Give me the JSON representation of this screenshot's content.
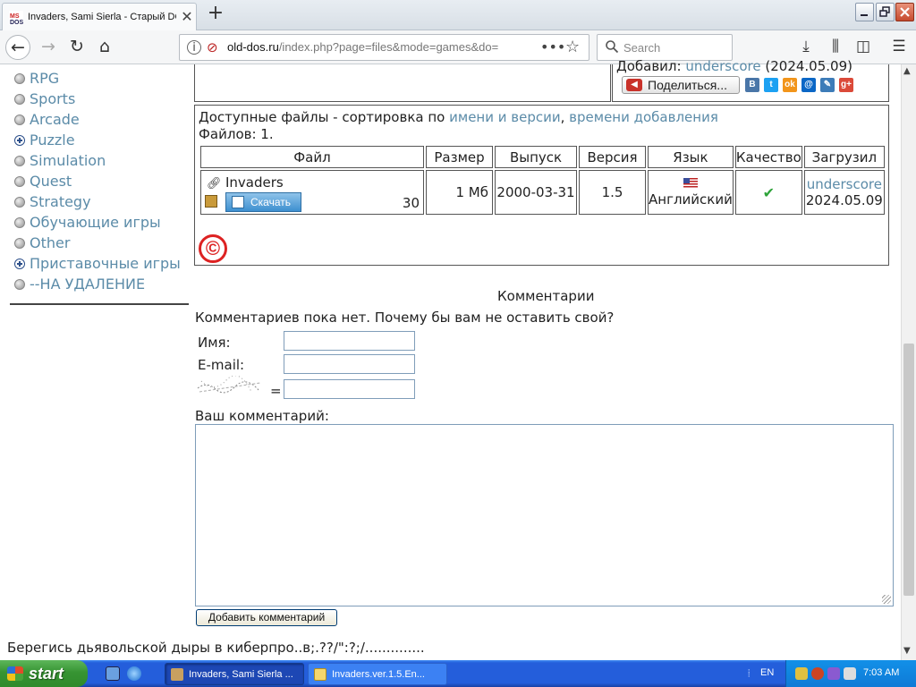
{
  "browser": {
    "tab_title": "Invaders, Sami Sierla - Старый DOS",
    "new_tab_label": "+",
    "url_host": "old-dos.ru",
    "url_path": "/index.php?page=files&mode=games&do=",
    "search_placeholder": "Search"
  },
  "sidebar": {
    "items": [
      {
        "label": "RPG",
        "icon": "bullet",
        "expandable": false
      },
      {
        "label": "Sports",
        "icon": "bullet",
        "expandable": false
      },
      {
        "label": "Arcade",
        "icon": "bullet",
        "expandable": false
      },
      {
        "label": "Puzzle",
        "icon": "plus",
        "expandable": true
      },
      {
        "label": "Simulation",
        "icon": "bullet",
        "expandable": false
      },
      {
        "label": "Quest",
        "icon": "bullet",
        "expandable": false
      },
      {
        "label": "Strategy",
        "icon": "bullet",
        "expandable": false
      },
      {
        "label": "Обучающие игры",
        "icon": "bullet",
        "expandable": false
      },
      {
        "label": "Other",
        "icon": "bullet",
        "expandable": false
      },
      {
        "label": "Приставочные игры",
        "icon": "plus",
        "expandable": true
      },
      {
        "label": "--НА УДАЛЕНИЕ",
        "icon": "bullet",
        "expandable": false
      }
    ]
  },
  "added": {
    "prefix": "Добавил:",
    "user": "underscore",
    "date": "(2024.05.09)"
  },
  "share": {
    "button_label": "Поделиться...",
    "networks": [
      {
        "name": "vk-icon",
        "glyph": "В",
        "color": "#4a76a8"
      },
      {
        "name": "twitter-icon",
        "glyph": "t",
        "color": "#1da1f2"
      },
      {
        "name": "odnoklassniki-icon",
        "glyph": "ok",
        "color": "#f2951b"
      },
      {
        "name": "mailru-icon",
        "glyph": "@",
        "color": "#0b67c6"
      },
      {
        "name": "livejournal-icon",
        "glyph": "✎",
        "color": "#3d7cb8"
      },
      {
        "name": "googleplus-icon",
        "glyph": "g+",
        "color": "#db4a39"
      }
    ]
  },
  "files": {
    "sort_prefix": "Доступные файлы - сортировка по",
    "sort_by_name": "имени и версии",
    "sort_separator": ",",
    "sort_by_date": "времени добавления",
    "count_label": "Файлов: 1.",
    "headers": [
      "Файл",
      "Размер",
      "Выпуск",
      "Версия",
      "Язык",
      "Качество",
      "Загрузил"
    ],
    "rows": [
      {
        "file_name": "Invaders",
        "download_label": "Скачать",
        "download_count": "30",
        "size": "1 Мб",
        "release": "2000-03-31",
        "version": "1.5",
        "language": "Английский",
        "quality": "good",
        "uploader": "underscore",
        "upload_date": "2024.05.09"
      }
    ],
    "copyright_glyph": "©"
  },
  "comments": {
    "title": "Комментарии",
    "empty_message": "Комментариев пока нет. Почему бы вам не оставить свой?",
    "name_label": "Имя:",
    "email_label": "E-mail:",
    "captcha_equals": "=",
    "comment_label": "Ваш комментарий:",
    "submit_label": "Добавить комментарий"
  },
  "footer": {
    "text": "Берегись дьявольской дыры в киберпро..в;.??/\":?;/.............."
  },
  "taskbar": {
    "start_label": "start",
    "tasks": [
      {
        "label": "Invaders, Sami Sierla ...",
        "active": true
      },
      {
        "label": "Invaders.ver.1.5.En...",
        "active": false
      }
    ],
    "language": "EN",
    "clock": "7:03 AM"
  },
  "colors": {
    "link": "#5b8ba8",
    "download_button": "#3d8fcf",
    "taskbar": "#245edb",
    "start_button": "#379433",
    "copyright": "#dd2222"
  }
}
